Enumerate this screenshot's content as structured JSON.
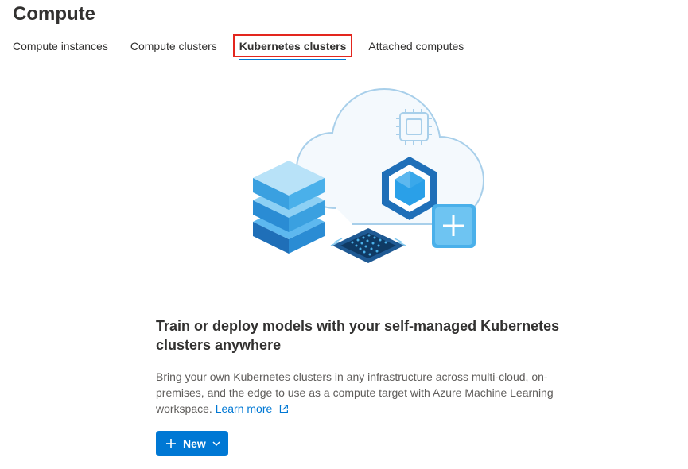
{
  "pageTitle": "Compute",
  "tabs": {
    "instances": "Compute instances",
    "clusters": "Compute clusters",
    "kubernetes": "Kubernetes clusters",
    "attached": "Attached computes"
  },
  "content": {
    "headline": "Train or deploy models with your self-managed Kubernetes clusters anywhere",
    "description": "Bring your own Kubernetes clusters in any infrastructure across multi-cloud, on-premises, and the edge to use as a compute target with Azure Machine Learning workspace. ",
    "learnMore": "Learn more",
    "newButton": "New"
  }
}
